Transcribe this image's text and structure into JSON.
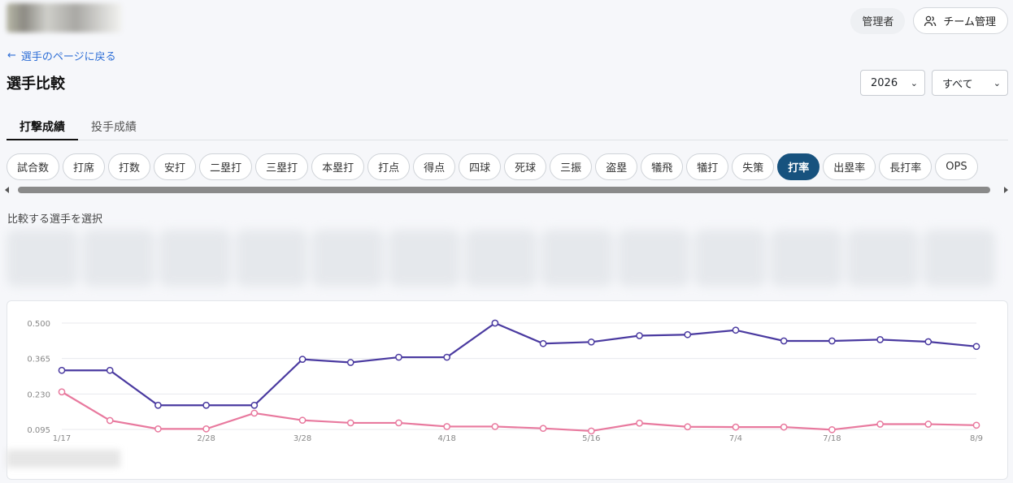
{
  "header": {
    "role_label": "管理者",
    "team_button_label": "チーム管理",
    "team_icon": "users-icon"
  },
  "nav": {
    "back_link": "選手のページに戻る",
    "back_icon": "arrow-left-icon"
  },
  "page": {
    "title": "選手比較"
  },
  "filters": {
    "year_value": "2026",
    "scope_value": "すべて"
  },
  "tabs": [
    {
      "label": "打撃成績",
      "active": true
    },
    {
      "label": "投手成績",
      "active": false
    }
  ],
  "stat_chips": [
    {
      "label": "試合数"
    },
    {
      "label": "打席"
    },
    {
      "label": "打数"
    },
    {
      "label": "安打"
    },
    {
      "label": "二塁打"
    },
    {
      "label": "三塁打"
    },
    {
      "label": "本塁打"
    },
    {
      "label": "打点"
    },
    {
      "label": "得点"
    },
    {
      "label": "四球"
    },
    {
      "label": "死球"
    },
    {
      "label": "三振"
    },
    {
      "label": "盗塁"
    },
    {
      "label": "犠飛"
    },
    {
      "label": "犠打"
    },
    {
      "label": "失策"
    },
    {
      "label": "打率",
      "active": true
    },
    {
      "label": "出塁率"
    },
    {
      "label": "長打率"
    },
    {
      "label": "OPS"
    }
  ],
  "players_section": {
    "label": "比較する選手を選択"
  },
  "colors": {
    "active_chip": "#17527e",
    "link": "#2f6fd6",
    "series_1": "#4a3aa0",
    "series_2": "#e8799e"
  },
  "chart_data": {
    "type": "line",
    "yticks": [
      "0.500",
      "0.365",
      "0.230",
      "0.095"
    ],
    "ylim": [
      0.095,
      0.5
    ],
    "x_tick_labels": [
      "1/17",
      "2/28",
      "3/28",
      "4/18",
      "5/16",
      "7/4",
      "7/18",
      "8/9"
    ],
    "grid": true,
    "series": [
      {
        "color": "#4a3aa0",
        "values": [
          0.32,
          0.32,
          0.187,
          0.187,
          0.187,
          0.362,
          0.35,
          0.37,
          0.37,
          0.5,
          0.422,
          0.428,
          0.452,
          0.456,
          0.473,
          0.432,
          0.432,
          0.437,
          0.429,
          0.411
        ]
      },
      {
        "color": "#e8799e",
        "values": [
          0.238,
          0.129,
          0.097,
          0.097,
          0.157,
          0.13,
          0.12,
          0.12,
          0.106,
          0.106,
          0.099,
          0.089,
          0.119,
          0.105,
          0.104,
          0.104,
          0.094,
          0.115,
          0.115,
          0.111
        ]
      }
    ]
  }
}
